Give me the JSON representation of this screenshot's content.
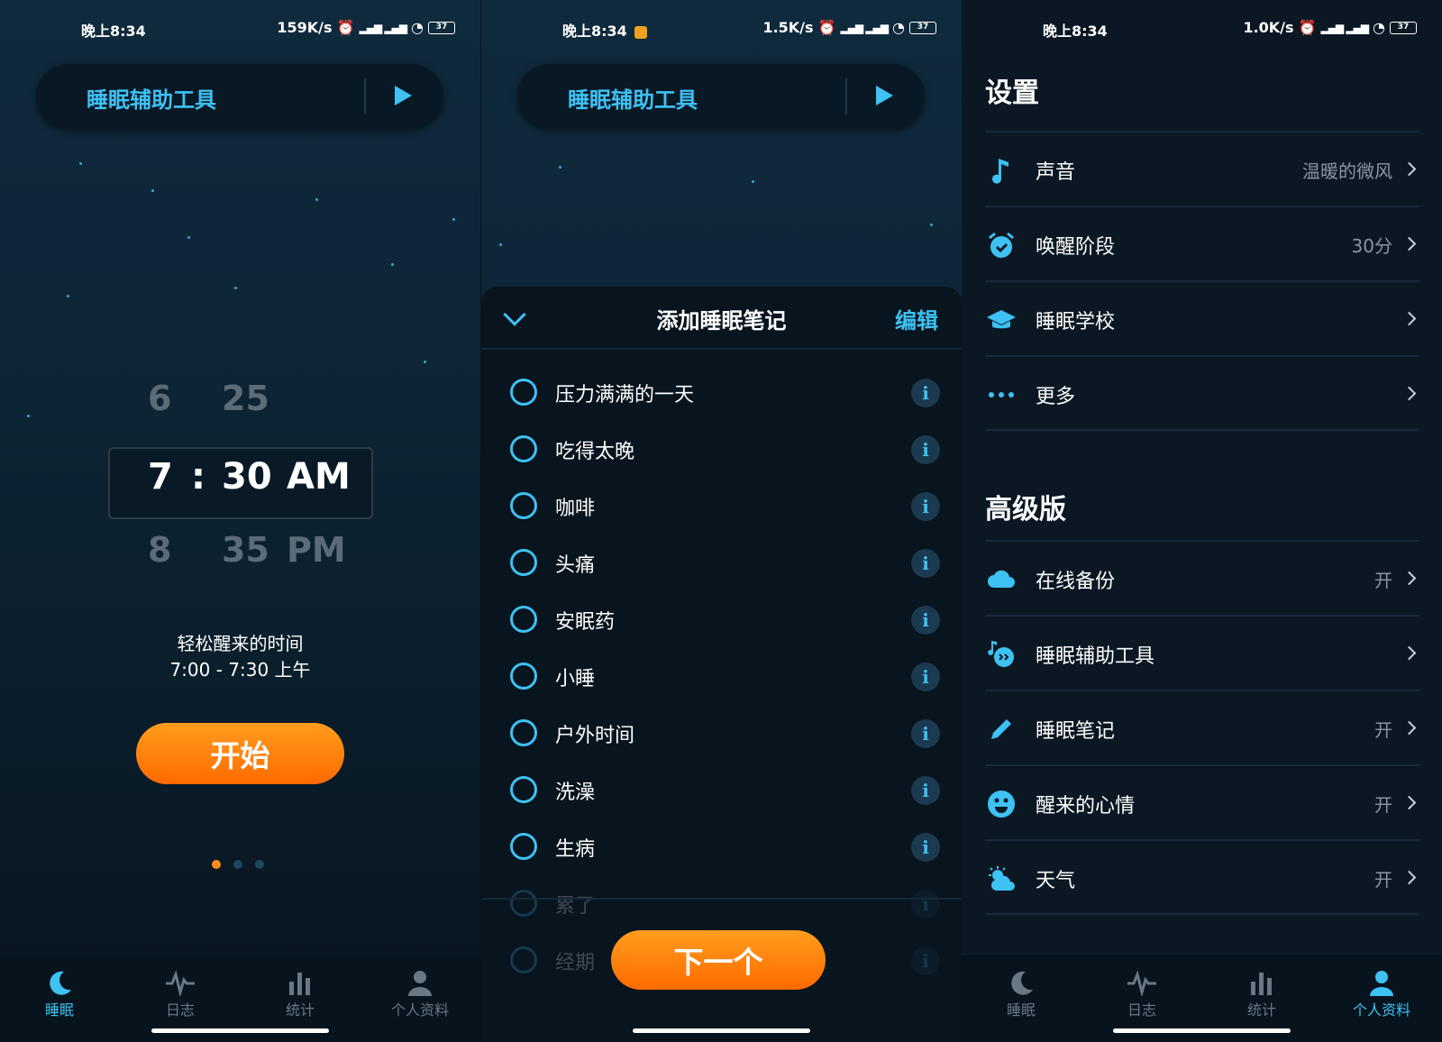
{
  "status": {
    "p1": {
      "time": "晚上8:34",
      "speed": "159K/s",
      "battery": "37"
    },
    "p2": {
      "time": "晚上8:34",
      "speed": "1.5K/s",
      "battery": "37"
    },
    "p3": {
      "time": "晚上8:34",
      "speed": "1.0K/s",
      "battery": "37"
    }
  },
  "pill": {
    "label": "睡眠辅助工具"
  },
  "picker": {
    "prev": {
      "hour": "6",
      "minute": "25"
    },
    "current": {
      "hour": "7",
      "sep": ":",
      "minute": "30",
      "ampm": "AM"
    },
    "next": {
      "hour": "8",
      "minute": "35",
      "ampm": "PM"
    }
  },
  "wake": {
    "label": "轻松醒来的时间",
    "range": "7:00 - 7:30 上午"
  },
  "start_label": "开始",
  "page_dots": {
    "count": 3,
    "active": 0
  },
  "tabs": [
    {
      "label": "睡眠",
      "icon": "moon-icon"
    },
    {
      "label": "日志",
      "icon": "pulse-icon"
    },
    {
      "label": "统计",
      "icon": "bar-chart-icon"
    },
    {
      "label": "个人资料",
      "icon": "person-icon"
    }
  ],
  "sheet": {
    "title": "添加睡眠笔记",
    "edit": "编辑",
    "items": [
      "压力满满的一天",
      "吃得太晚",
      "咖啡",
      "头痛",
      "安眠药",
      "小睡",
      "户外时间",
      "洗澡",
      "生病",
      "累了",
      "经期"
    ],
    "next_label": "下一个"
  },
  "settings": {
    "title": "设置",
    "rows": [
      {
        "label": "声音",
        "value": "温暖的微风",
        "icon": "music-note-icon"
      },
      {
        "label": "唤醒阶段",
        "value": "30分",
        "icon": "alarm-icon"
      },
      {
        "label": "睡眠学校",
        "value": "",
        "icon": "graduation-cap-icon"
      },
      {
        "label": "更多",
        "value": "",
        "icon": "more-dots-icon"
      }
    ]
  },
  "premium": {
    "title": "高级版",
    "rows": [
      {
        "label": "在线备份",
        "value": "开",
        "icon": "cloud-icon"
      },
      {
        "label": "睡眠辅助工具",
        "value": "",
        "icon": "sleep-aid-icon"
      },
      {
        "label": "睡眠笔记",
        "value": "开",
        "icon": "pencil-icon"
      },
      {
        "label": "醒来的心情",
        "value": "开",
        "icon": "smiley-icon"
      },
      {
        "label": "天气",
        "value": "开",
        "icon": "weather-icon"
      }
    ]
  },
  "colors": {
    "accent": "#3ec1f3",
    "orange": "#ff7a0a",
    "bg": "#0b1823"
  }
}
